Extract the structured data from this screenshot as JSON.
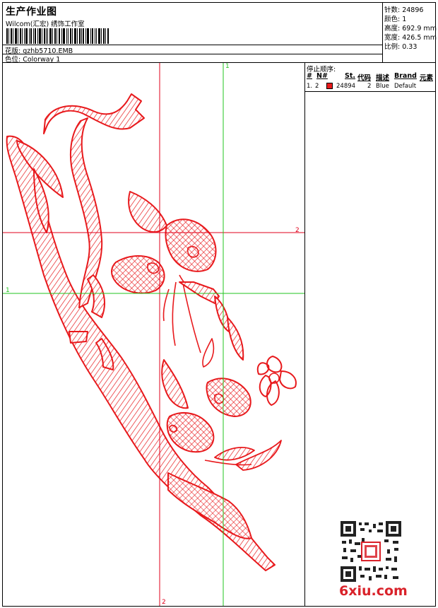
{
  "header": {
    "title": "生产作业图",
    "subtitle": "Wilcom(汇宏) 绣饰工作室",
    "design_row": "花版: gzhb5710.EMB",
    "colorway_row": "色位: Colorway 1"
  },
  "stats": {
    "stitches": "针数: 24896",
    "colors": "颜色: 1",
    "height": "高度: 692.9 mm",
    "width": "宽度: 426.5 mm",
    "scale": "比例: 0.33"
  },
  "stop_sequence": {
    "heading": "停止顺序:",
    "columns": [
      "#",
      "N#",
      "St.",
      "代码",
      "描述",
      "Brand",
      "元素"
    ],
    "rows": [
      {
        "idx": "1.",
        "needle": "2",
        "stitches": "24894",
        "code": "2",
        "desc": "Blue",
        "brand": "Default",
        "color": "#e8191c"
      }
    ]
  },
  "guides": {
    "top_green": "1",
    "right_red": "2",
    "left_green": "1",
    "bottom_red": "2"
  },
  "colors": {
    "thread": "#e8191c",
    "guide_red": "#e0001b",
    "guide_green": "#22c41f"
  },
  "watermark": {
    "brand": "6xiu.com",
    "brand_color": "#d9222a"
  }
}
